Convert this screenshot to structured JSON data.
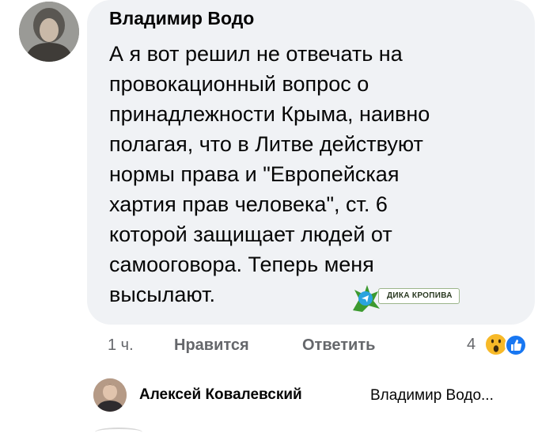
{
  "comment": {
    "author": "Владимир Водо",
    "text": "А я вот решил не отвечать на\nпровокационный вопрос о\nпринадлежности Крыма, наивно\nполагая, что в Литве действуют\nнормы права и \"Европейская\nхартия прав человека\", ст. 6\nкоторой защищает людей от\nсамооговора. Теперь меня\nвысылают.",
    "watermark": "ДИКА КРОПИВА",
    "time": "1 ч.",
    "like_label": "Нравится",
    "reply_label": "Ответить",
    "reaction_count": "4",
    "reaction_icons": [
      "wow-icon",
      "like-icon"
    ]
  },
  "reply": {
    "author": "Алексей Ковалевский",
    "preview": "Владимир Водо..."
  },
  "colors": {
    "bubble": "#f0f2f5",
    "meta_text": "#65676b",
    "like_blue": "#1877f2",
    "wow_yellow": "#f7b928"
  }
}
